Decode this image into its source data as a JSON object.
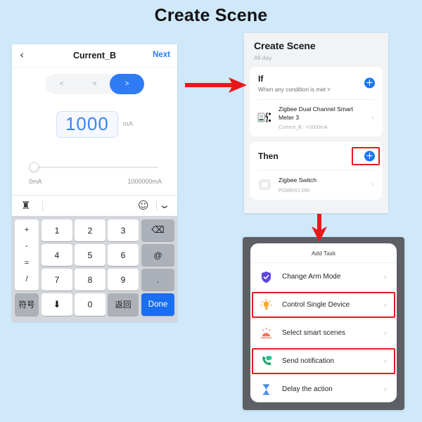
{
  "page": {
    "title": "Create Scene",
    "background_color": "#cfe8fa",
    "accent_color": "#1878f2",
    "highlight_color": "#e8191b"
  },
  "left_phone": {
    "navbar": {
      "back_icon": "chevron-left-icon",
      "back_glyph": "‹",
      "title": "Current_B",
      "next_label": "Next"
    },
    "comparator": {
      "options": [
        "<",
        "=",
        ">"
      ],
      "selected": ">"
    },
    "value": {
      "number": "1000",
      "unit": "mA"
    },
    "slider": {
      "min_label": "0mA",
      "max_label": "1000000mA",
      "position_percent": 0
    },
    "keyboard_toolbar": {
      "left_icon": "handwriting-input-icon",
      "left_glyph": "♜",
      "emoji_icon": "smiley-icon",
      "emoji_glyph": "☺",
      "collapse_icon": "chevron-down-icon",
      "collapse_glyph": "⌄"
    },
    "keyboard": {
      "symbol_column": [
        "+",
        "-",
        "=",
        "/"
      ],
      "row1": [
        "1",
        "2",
        "3"
      ],
      "row2": [
        "4",
        "5",
        "6"
      ],
      "row3": [
        "7",
        "8",
        "9"
      ],
      "backspace": {
        "name": "backspace-key",
        "glyph": "⌫"
      },
      "at": "@",
      "dot": ".",
      "symbols_key": "符号",
      "space_key": {
        "name": "voice-space-key",
        "glyph": "⬇"
      },
      "zero": "0",
      "return_key": "返回",
      "done_key": "Done"
    }
  },
  "scene_panel": {
    "title": "Create Scene",
    "subtitle": "All day",
    "if_section": {
      "title": "If",
      "subtitle": "When any condition is met ˅",
      "add_icon": "plus-circle-icon",
      "add_glyph": "+",
      "condition": {
        "icon": "zigbee-meter-icon",
        "name": "Zigbee Dual Channel Smart Meter 3",
        "detail": "Current_B : >1000mA",
        "chevron": "›"
      }
    },
    "then_section": {
      "title": "Then",
      "add_icon": "plus-circle-icon",
      "add_glyph": "+",
      "highlighted": true,
      "action": {
        "icon": "zigbee-switch-icon",
        "name": "Zigbee Switch",
        "detail": "POWER1:ON",
        "chevron": "›"
      }
    }
  },
  "add_task_panel": {
    "title": "Add Task",
    "items": [
      {
        "label": "Change Arm Mode",
        "icon": "shield-check-icon",
        "highlighted": false,
        "chevron": "›"
      },
      {
        "label": "Control Single Device",
        "icon": "lightbulb-icon",
        "highlighted": true,
        "chevron": "›"
      },
      {
        "label": "Select smart scenes",
        "icon": "smart-scene-icon",
        "highlighted": false,
        "chevron": "›"
      },
      {
        "label": "Send notification",
        "icon": "phone-message-icon",
        "highlighted": true,
        "chevron": "›"
      },
      {
        "label": "Delay the action",
        "icon": "hourglass-icon",
        "highlighted": false,
        "chevron": "›"
      }
    ]
  },
  "arrows": [
    {
      "name": "arrow-left-to-scene",
      "direction": "right",
      "color": "#e8191b"
    },
    {
      "name": "arrow-scene-to-tasks",
      "direction": "down",
      "color": "#e8191b"
    }
  ]
}
